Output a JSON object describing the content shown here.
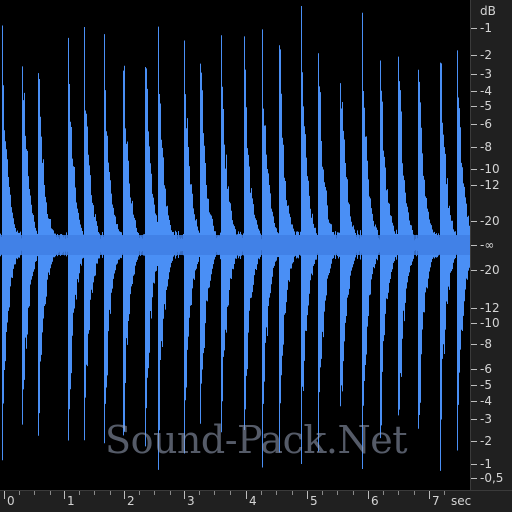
{
  "colors": {
    "background": "#000000",
    "waveform": "#4a8ff5",
    "centerline": "#3f7fe4",
    "ruler_background": "#202020",
    "ruler_text": "#d4d4d4"
  },
  "db_scale": {
    "title": "dB",
    "labels": [
      "-1",
      "-2",
      "-3",
      "-4",
      "-5",
      "-6",
      "-8",
      "-10",
      "-12",
      "-20",
      "-∞",
      "-20",
      "-12",
      "-10",
      "-8",
      "-6",
      "-5",
      "-4",
      "-3",
      "-2",
      "-1",
      "-0,5"
    ]
  },
  "time_ruler": {
    "labels": [
      "0",
      "1",
      "2",
      "3",
      "4",
      "5",
      "6",
      "7"
    ],
    "unit": "sec"
  },
  "watermark": "Sound-Pack.Net"
}
